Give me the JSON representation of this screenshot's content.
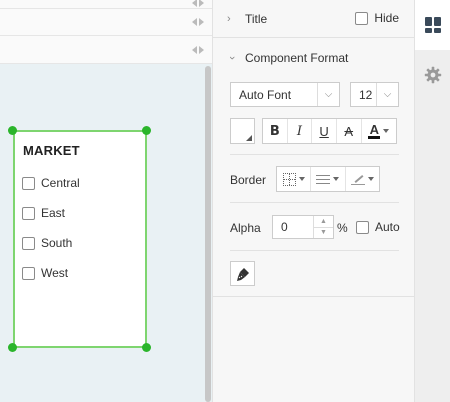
{
  "canvas": {
    "widget": {
      "title": "MARKET",
      "items": [
        "Central",
        "East",
        "South",
        "West"
      ],
      "border_color": "#7ed56f",
      "handle_color": "#2bb52b"
    }
  },
  "panel": {
    "title_section": {
      "label": "Title",
      "hide_label": "Hide",
      "hide_checked": false
    },
    "format_section": {
      "label": "Component Format",
      "font": "Auto Font",
      "font_size": "12",
      "style_buttons": {
        "bold": "B",
        "italic": "I",
        "underline": "U",
        "strike": "A",
        "font_color": "A"
      },
      "border_label": "Border",
      "alpha_label": "Alpha",
      "alpha_value": "0",
      "alpha_unit": "%",
      "auto_label": "Auto",
      "auto_checked": false
    }
  },
  "tabs": [
    {
      "icon": "dashboard-icon",
      "active": true
    },
    {
      "icon": "gear-icon",
      "active": false
    }
  ],
  "colors": {
    "canvas_bg": "#e9f1f4",
    "panel_bg": "#f7f7f7",
    "accent_dark": "#3a4a5a"
  }
}
